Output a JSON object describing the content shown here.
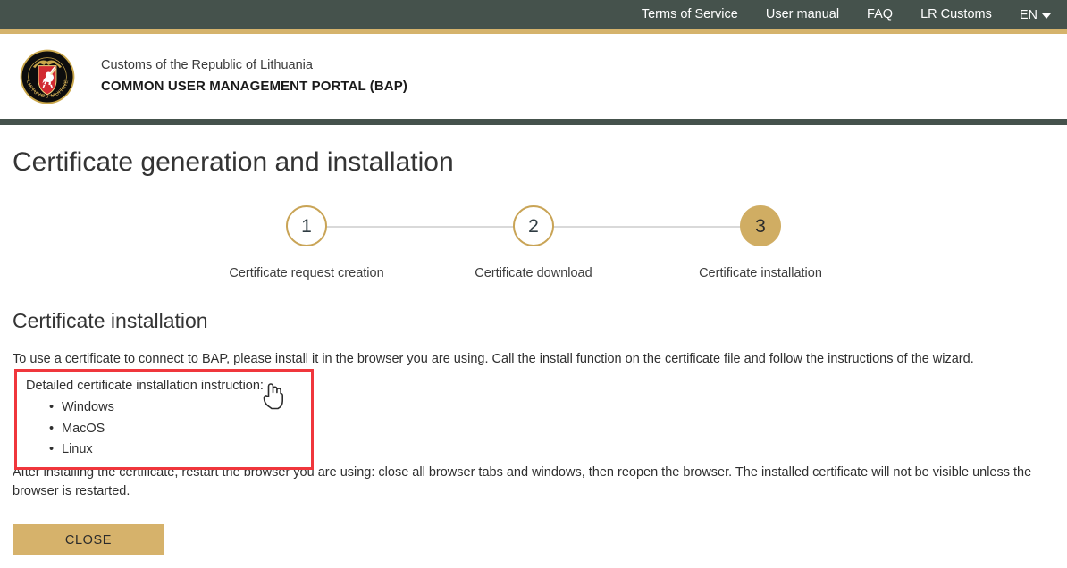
{
  "topbar": {
    "links": [
      {
        "label": "Terms of Service",
        "name": "terms-of-service-link"
      },
      {
        "label": "User manual",
        "name": "user-manual-link"
      },
      {
        "label": "FAQ",
        "name": "faq-link"
      },
      {
        "label": "LR Customs",
        "name": "lr-customs-link"
      }
    ],
    "language": "EN",
    "background_color": "#45524c"
  },
  "accent": {
    "gold": "#d5b36c",
    "gold_button": "#d6b26b",
    "dark_green": "#45524c",
    "highlight_red": "#f0363c"
  },
  "brand": {
    "logo_name": "lithuanian-customs-emblem",
    "logo_ring_text_left": "LIETUVOS",
    "logo_ring_text_right": "MUITINĖ",
    "organization": "Customs of the Republic of Lithuania",
    "portal": "COMMON USER MANAGEMENT PORTAL (BAP)"
  },
  "page": {
    "title": "Certificate generation and installation"
  },
  "stepper": {
    "steps": [
      {
        "number": "1",
        "label": "Certificate request creation",
        "active": false
      },
      {
        "number": "2",
        "label": "Certificate download",
        "active": false
      },
      {
        "number": "3",
        "label": "Certificate installation",
        "active": true
      }
    ]
  },
  "section": {
    "heading": "Certificate installation",
    "intro": "To use a certificate to connect to BAP, please install it in the browser you are using. Call the install function on the certificate file and follow the instructions of the wizard.",
    "outro": "After installing the certificate, restart the browser you are using: close all browser tabs and windows, then reopen the browser. The installed certificate will not be visible unless the browser is restarted."
  },
  "instructions": {
    "intro": "Detailed certificate installation instruction:",
    "items": [
      {
        "label": "Windows"
      },
      {
        "label": "MacOS"
      },
      {
        "label": "Linux"
      }
    ],
    "cursor_icon": "pointing-hand-cursor"
  },
  "actions": {
    "close_label": "CLOSE"
  }
}
